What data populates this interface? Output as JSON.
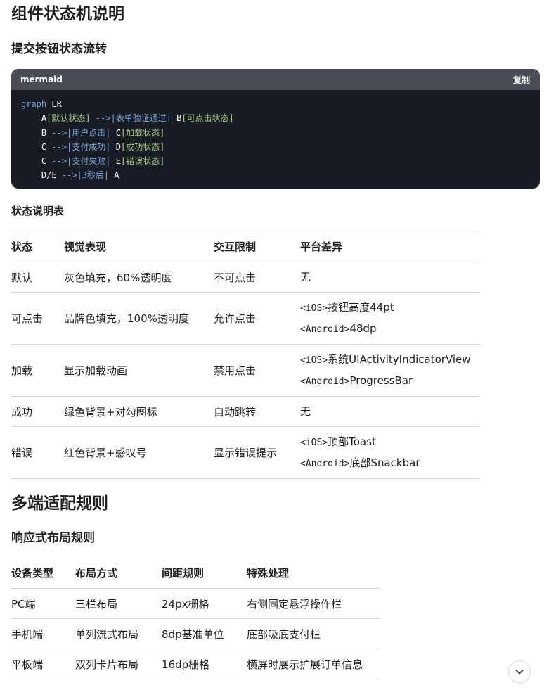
{
  "h1_state_machine": "组件状态机说明",
  "h2_submit_flow": "提交按钮状态流转",
  "code": {
    "lang": "mermaid",
    "copy_label": "复制",
    "lines": [
      [
        {
          "t": "graph",
          "c": "kw"
        },
        {
          "t": " LR",
          "c": "node"
        }
      ],
      [
        {
          "t": "    A",
          "c": "node"
        },
        {
          "t": "[默认状态]",
          "c": "lbl"
        },
        {
          "t": " -->|表单验证通过| ",
          "c": "arrow"
        },
        {
          "t": "B",
          "c": "node"
        },
        {
          "t": "[可点击状态]",
          "c": "lbl"
        }
      ],
      [
        {
          "t": "    B",
          "c": "node"
        },
        {
          "t": " -->|用户点击| ",
          "c": "arrow"
        },
        {
          "t": "C",
          "c": "node"
        },
        {
          "t": "[加载状态]",
          "c": "lbl"
        }
      ],
      [
        {
          "t": "    C",
          "c": "node"
        },
        {
          "t": " -->|支付成功| ",
          "c": "arrow"
        },
        {
          "t": "D",
          "c": "node"
        },
        {
          "t": "[成功状态]",
          "c": "lbl"
        }
      ],
      [
        {
          "t": "    C",
          "c": "node"
        },
        {
          "t": " -->|支付失败| ",
          "c": "arrow"
        },
        {
          "t": "E",
          "c": "node"
        },
        {
          "t": "[错误状态]",
          "c": "lbl"
        }
      ],
      [
        {
          "t": "    D/E",
          "c": "node"
        },
        {
          "t": " -->|3秒后| ",
          "c": "arrow"
        },
        {
          "t": "A",
          "c": "node"
        }
      ]
    ]
  },
  "h3_status_table": "状态说明表",
  "status_table": {
    "headers": [
      "状态",
      "视觉表现",
      "交互限制",
      "平台差异"
    ],
    "rows": [
      {
        "state": "默认",
        "visual": "灰色填充，60%透明度",
        "interaction": "不可点击",
        "platform": [
          {
            "tag": "",
            "text": "无"
          }
        ]
      },
      {
        "state": "可点击",
        "visual": "品牌色填充，100%透明度",
        "interaction": "允许点击",
        "platform": [
          {
            "tag": "<iOS>",
            "text": "按钮高度44pt"
          },
          {
            "tag": "<Android>",
            "text": "48dp"
          }
        ]
      },
      {
        "state": "加载",
        "visual": "显示加载动画",
        "interaction": "禁用点击",
        "platform": [
          {
            "tag": "<iOS>",
            "text": "系统UIActivityIndicatorView"
          },
          {
            "tag": "<Android>",
            "text": "ProgressBar"
          }
        ]
      },
      {
        "state": "成功",
        "visual": "绿色背景+对勾图标",
        "interaction": "自动跳转",
        "platform": [
          {
            "tag": "",
            "text": "无"
          }
        ]
      },
      {
        "state": "错误",
        "visual": "红色背景+感叹号",
        "interaction": "显示错误提示",
        "platform": [
          {
            "tag": "<iOS>",
            "text": "顶部Toast"
          },
          {
            "tag": "<Android>",
            "text": "底部Snackbar"
          }
        ]
      }
    ]
  },
  "h1_multi": "多端适配规则",
  "h2_responsive": "响应式布局规则",
  "device_table": {
    "headers": [
      "设备类型",
      "布局方式",
      "间距规则",
      "特殊处理"
    ],
    "rows": [
      [
        "PC端",
        "三栏布局",
        "24px栅格",
        "右侧固定悬浮操作栏"
      ],
      [
        "手机端",
        "单列流式布局",
        "8dp基准单位",
        "底部吸底支付栏"
      ],
      [
        "平板端",
        "双列卡片布局",
        "16dp栅格",
        "横屏时展示扩展订单信息"
      ]
    ]
  },
  "icons": {
    "scroll_down": "chevron-down-icon"
  }
}
